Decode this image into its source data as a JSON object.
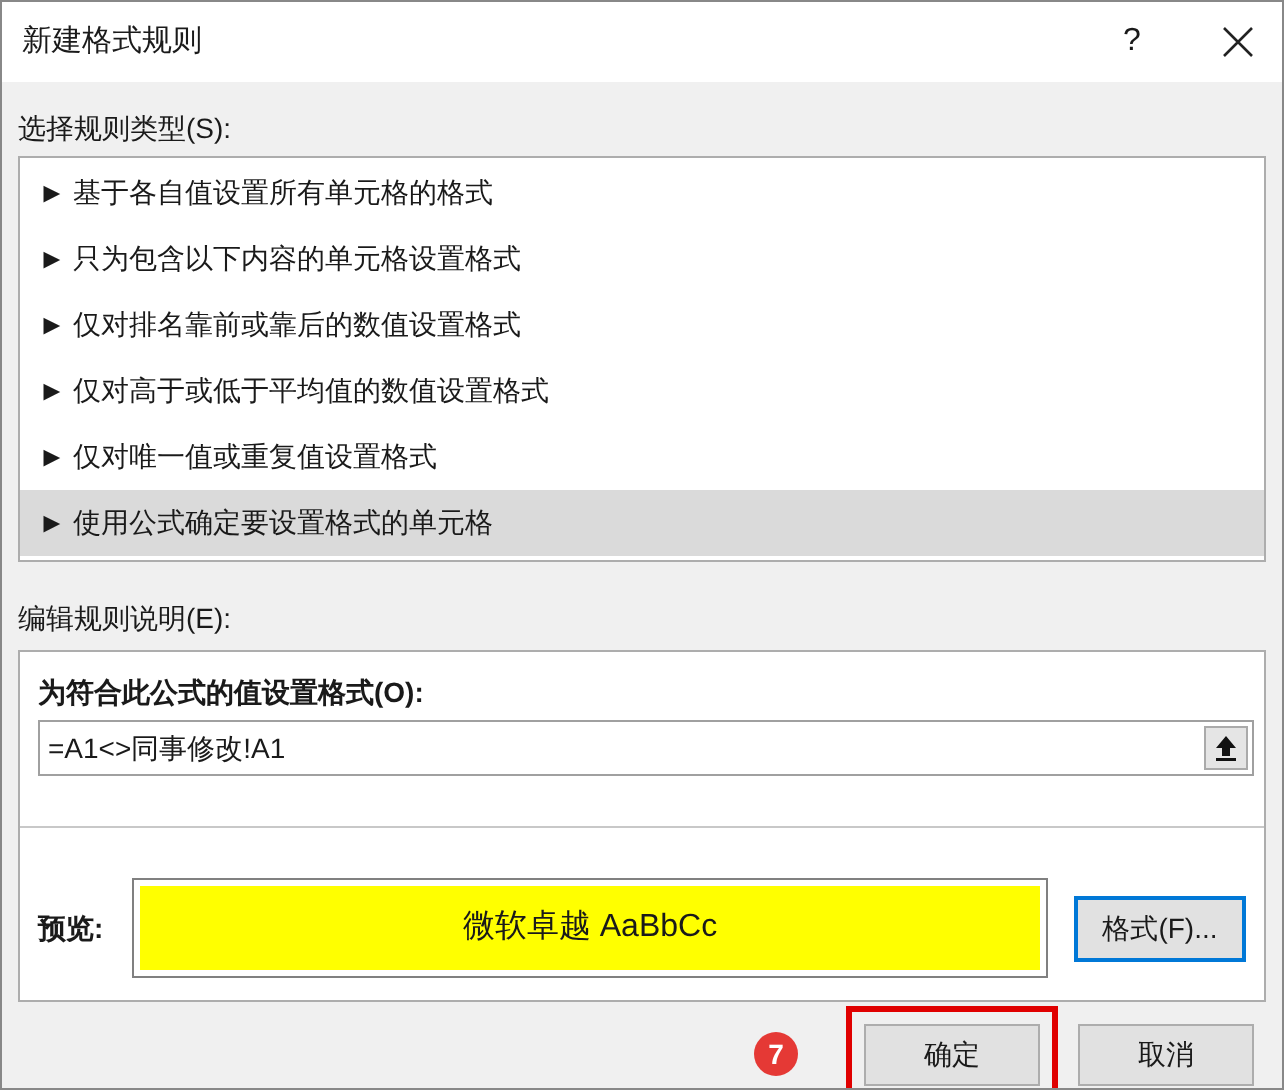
{
  "window": {
    "title": "新建格式规则",
    "help": "?"
  },
  "rule_type": {
    "label": "选择规则类型(S):",
    "items": [
      {
        "label": "► 基于各自值设置所有单元格的格式",
        "selected": false
      },
      {
        "label": "► 只为包含以下内容的单元格设置格式",
        "selected": false
      },
      {
        "label": "► 仅对排名靠前或靠后的数值设置格式",
        "selected": false
      },
      {
        "label": "► 仅对高于或低于平均值的数值设置格式",
        "selected": false
      },
      {
        "label": "► 仅对唯一值或重复值设置格式",
        "selected": false
      },
      {
        "label": "► 使用公式确定要设置格式的单元格",
        "selected": true
      }
    ]
  },
  "edit_rule": {
    "label": "编辑规则说明(E):",
    "formula_label": "为符合此公式的值设置格式(O):",
    "formula": "=A1<>同事修改!A1",
    "preview_label": "预览:",
    "preview_text": "微软卓越  AaBbCc",
    "format_button": "格式(F)..."
  },
  "step_badge": "7",
  "buttons": [
    {
      "label": "确定",
      "highlighted": true
    },
    {
      "label": "取消",
      "highlighted": false
    }
  ]
}
